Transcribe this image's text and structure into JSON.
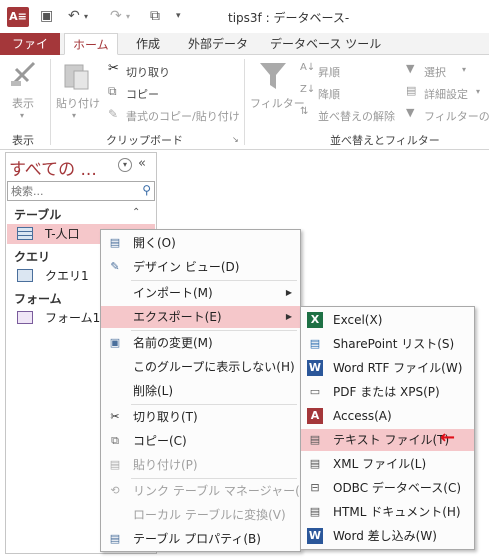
{
  "window": {
    "title": "tips3f : データベース-",
    "logo": "A≡"
  },
  "ribbon": {
    "tabs": [
      "ファイル",
      "ホーム",
      "作成",
      "外部データ",
      "データベース ツール"
    ],
    "view": {
      "label": "表示",
      "group": "表示"
    },
    "clipboard": {
      "paste": "貼り付け",
      "cut": "切り取り",
      "copy": "コピー",
      "format_painter": "書式のコピー/貼り付け",
      "group": "クリップボード"
    },
    "filter": {
      "label": "フィルター",
      "asc": "昇順",
      "desc": "降順",
      "clear_sort": "並べ替えの解除",
      "select": "選択",
      "advanced": "詳細設定",
      "toggle": "フィルターの実",
      "group": "並べ替えとフィルター"
    }
  },
  "nav": {
    "header": "すべての ...",
    "search_placeholder": "検索...",
    "groups": [
      "テーブル",
      "クエリ",
      "フォーム"
    ],
    "items": {
      "table": "T-人口",
      "query": "クエリ1",
      "form": "フォーム1"
    }
  },
  "context_menu": [
    "開く(O)",
    "デザイン ビュー(D)",
    "インポート(M)",
    "エクスポート(E)",
    "名前の変更(M)",
    "このグループに表示しない(H)",
    "削除(L)",
    "切り取り(T)",
    "コピー(C)",
    "貼り付け(P)",
    "リンク テーブル マネージャー(K)",
    "ローカル テーブルに変換(V)",
    "テーブル プロパティ(B)"
  ],
  "export_menu": [
    "Excel(X)",
    "SharePoint リスト(S)",
    "Word RTF ファイル(W)",
    "PDF または XPS(P)",
    "Access(A)",
    "テキスト ファイル(T)",
    "XML ファイル(L)",
    "ODBC データベース(C)",
    "HTML ドキュメント(H)",
    "Word 差し込み(W)"
  ],
  "annotation": {
    "arrow": "←",
    "color": "#e0101a"
  },
  "colors": {
    "accent": "#a4373a",
    "highlight": "#f5c7ca"
  }
}
